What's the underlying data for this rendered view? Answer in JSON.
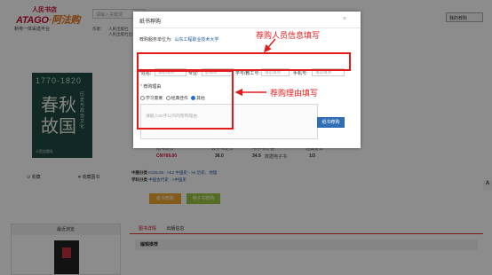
{
  "site": {
    "logo_small": "人民书店",
    "logo_brand": "ATAGO",
    "logo_brand_suffix": "·阿法购",
    "logo_tagline": "新电一体采选平台",
    "search_placeholder": "请输入关键词",
    "pub_label1": "作者：",
    "pub_label2": "人民出版社",
    "pub_label3": "人民出版社出",
    "my_recommend": "我的荐购"
  },
  "book": {
    "cover_top": "1770-1820",
    "cover_big": "春秋故国",
    "cover_side": "历史与政治文化",
    "cover_foot": "人民出版社",
    "collect": "⊙ 收藏",
    "favorite": "♥ 收藏图书"
  },
  "prices": {
    "col1_label": "纸书定价",
    "col1_value": "CNY69.00",
    "col2_label": "数字书定价",
    "col2_value": "36.0",
    "col3_label": "电子书价格",
    "col3_value": "34.9",
    "col3_note": "数据电子书",
    "col4_label": "馆藏复本",
    "col4_value": "1/3"
  },
  "classes": {
    "row1_key": "中图分类",
    "row1_text": "K225.09 - >K2 中国史 - >K 历史、地理",
    "row2_key": "学科分类",
    "row2_text": "中国古代史 - >中国史"
  },
  "buttons": {
    "orange": "纸书荐购",
    "green": "电子书荐购"
  },
  "lower": {
    "left_title": "最近浏览",
    "tab1": "图书详情",
    "tab2": "出版信息",
    "section": "编辑推荐",
    "side_tab": "A"
  },
  "modal": {
    "title": "纸书荐购",
    "close": "×",
    "unit_label": "荐购服务单位为:",
    "unit_value": "山东工程职业技术大学",
    "fields": {
      "name_label": "姓名:",
      "name_placeholder": "请必填项",
      "major_label": "专业:",
      "major_placeholder": "必填项",
      "id_label": "学号/教工号:",
      "id_placeholder": "请必填项",
      "phone_label": "手机号:",
      "phone_placeholder": "请必填项"
    },
    "reason_header_star": "*",
    "reason_header": "荐购理由",
    "options": [
      "学习需要",
      "经典佳作",
      "其他"
    ],
    "selected_option": "其他",
    "reason_placeholder": "请输入50字以内的荐购理由",
    "submit": "纸书荐购"
  },
  "annotations": {
    "top": "荐购人员信息填写",
    "reason": "荐购理由填写",
    "color": "#e21a1a"
  }
}
